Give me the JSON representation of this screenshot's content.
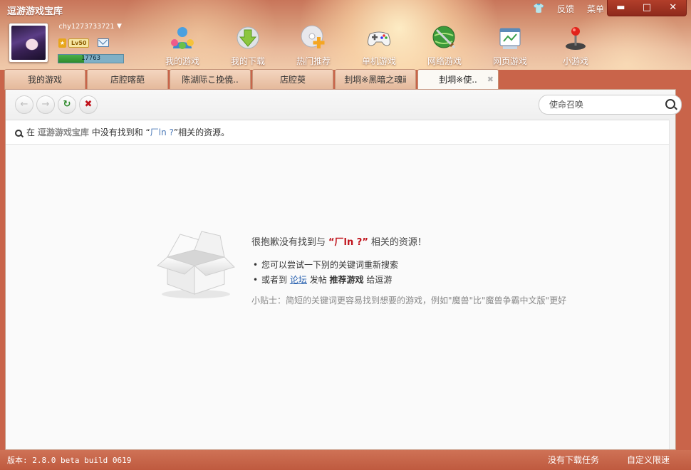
{
  "app": {
    "title": "逗游游戏宝库"
  },
  "titlebar": {
    "feedback": "反馈",
    "menu": "菜单",
    "minimize": "▬",
    "maximize": "□",
    "close": "✕"
  },
  "user": {
    "name": "chy1273733721",
    "level_badge": "Lv50",
    "xp_value": "17763",
    "xp_fraction": 0.4
  },
  "nav": [
    {
      "label": "我的游戏",
      "icon": "my-games-icon"
    },
    {
      "label": "我的下载",
      "icon": "download-icon"
    },
    {
      "label": "热门推荐",
      "icon": "disc-plus-icon"
    },
    {
      "label": "单机游戏",
      "icon": "gamepad-icon"
    },
    {
      "label": "网络游戏",
      "icon": "globe-sword-icon"
    },
    {
      "label": "网页游戏",
      "icon": "webpage-icon"
    },
    {
      "label": "小游戏",
      "icon": "joystick-icon"
    }
  ],
  "tabs": [
    {
      "label": "我的游戏",
      "active": false
    },
    {
      "label": "店腔喀葩",
      "active": false
    },
    {
      "label": "陈湖际こ挽僥..",
      "active": false
    },
    {
      "label": "店腔萸",
      "active": false
    },
    {
      "label": "刲垌※黑暗之魂ⅱ",
      "active": false
    },
    {
      "label": "刲垌※使..",
      "active": true
    }
  ],
  "toolbar": {
    "back": "←",
    "forward": "→",
    "refresh": "↻",
    "stop": "✖"
  },
  "search": {
    "value": "",
    "placeholder": "使命召唤"
  },
  "notice": {
    "pre": "在",
    "site": "逗游游戏宝库",
    "mid": "中没有找到和",
    "open_quote": "“",
    "keyword": "厂ln  ?",
    "close_quote": "”",
    "post": "相关的资源。"
  },
  "result": {
    "title_pre": "很抱歉没有找到与",
    "title_kw": "“厂ln  ?”",
    "title_post": "相关的资源！",
    "item1": "您可以尝试一下别的关键词重新搜索",
    "item2_pre": "或者到",
    "item2_link": "论坛",
    "item2_mid": "发帖",
    "item2_bold": "推荐游戏",
    "item2_post": "给逗游",
    "tip": "小贴士：简短的关键词更容易找到想要的游戏，例如\"魔兽\"比\"魔兽争霸中文版\"更好"
  },
  "status": {
    "version": "版本: 2.8.0 beta build 0619",
    "downloads": "没有下载任务",
    "speed": "自定义限速"
  }
}
